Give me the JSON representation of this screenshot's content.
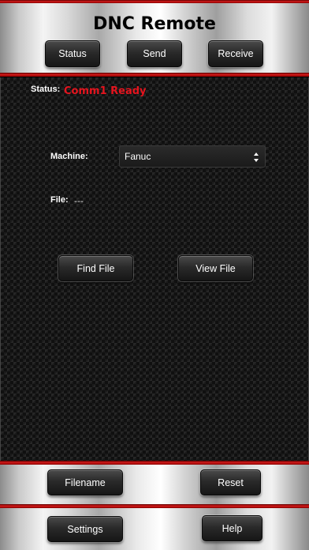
{
  "header": {
    "title": "DNC Remote",
    "buttons": {
      "status": "Status",
      "send": "Send",
      "receive": "Receive"
    }
  },
  "status": {
    "label": "Status:",
    "value": "Comm1 Ready",
    "value_color": "#e5141e"
  },
  "machine": {
    "label": "Machine:",
    "selected": "Fanuc"
  },
  "file": {
    "label": "File:",
    "value": "---"
  },
  "actions": {
    "find_file": "Find File",
    "view_file": "View File"
  },
  "footer": {
    "filename": "Filename",
    "reset": "Reset",
    "settings": "Settings",
    "help": "Help"
  },
  "icons": {
    "select_arrows": "updown-arrows-icon"
  },
  "colors": {
    "accent_red": "#d21a1a"
  }
}
